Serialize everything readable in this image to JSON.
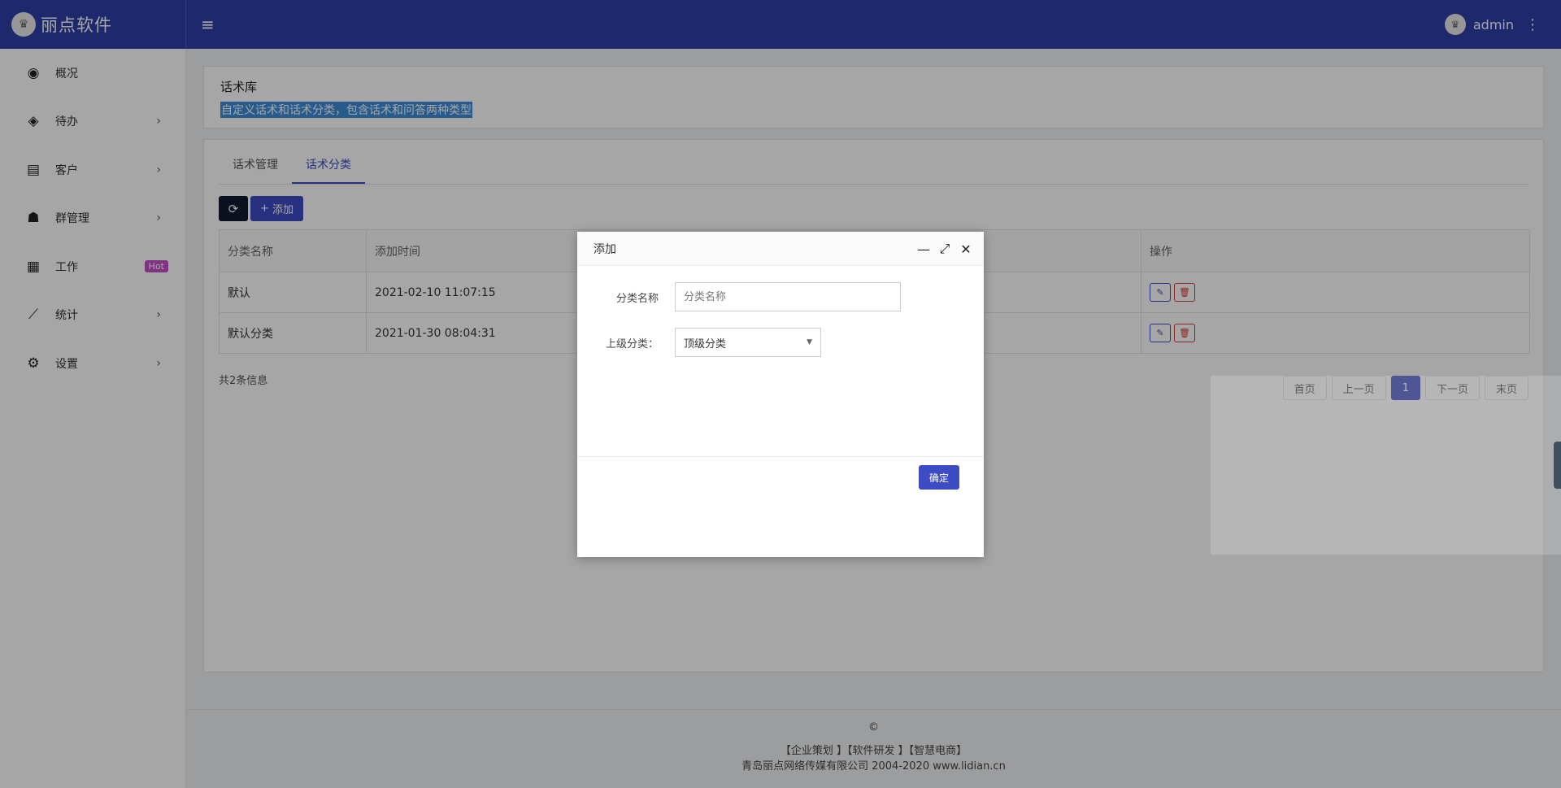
{
  "header": {
    "brand": "丽点软件",
    "menu_icon": "hamburger-icon",
    "user": "admin"
  },
  "sidebar": {
    "items": [
      {
        "label": "概况",
        "icon": "dashboard-icon"
      },
      {
        "label": "待办",
        "icon": "compass-icon"
      },
      {
        "label": "客户",
        "icon": "id-card-icon"
      },
      {
        "label": "群管理",
        "icon": "users-icon"
      },
      {
        "label": "工作",
        "icon": "grid-icon",
        "badge": "Hot"
      },
      {
        "label": "统计",
        "icon": "line-chart-icon"
      },
      {
        "label": "设置",
        "icon": "gear-icon"
      }
    ]
  },
  "page": {
    "title": "话术库",
    "description": "自定义话术和话术分类，包含话术和问答两种类型"
  },
  "tabs": [
    "话术管理",
    "话术分类"
  ],
  "toolbar": {
    "add_label": "添加"
  },
  "table": {
    "headers": [
      "分类名称",
      "添加时间",
      "操作"
    ],
    "rows": [
      {
        "name": "默认",
        "time": "2021-02-10 11:07:15"
      },
      {
        "name": "默认分类",
        "time": "2021-01-30 08:04:31"
      }
    ]
  },
  "summary": "共2条信息",
  "pager": {
    "first": "首页",
    "prev": "上一页",
    "current": "1",
    "next": "下一页",
    "last": "末页"
  },
  "footer": {
    "copyright": "©",
    "links": "【企业策划 】【软件研发 】【智慧电商】",
    "company": "青岛丽点网络传媒有限公司 2004-2020 www.lidian.cn"
  },
  "modal": {
    "title": "添加",
    "name_label": "分类名称",
    "name_placeholder": "分类名称",
    "parent_label": "上级分类：",
    "parent_value": "顶级分类",
    "ok": "确定"
  },
  "colors": {
    "primary": "#3e4cc4",
    "header_bg": "#2f3fa8",
    "danger": "#d9393b",
    "hot": "#c64fc9"
  }
}
